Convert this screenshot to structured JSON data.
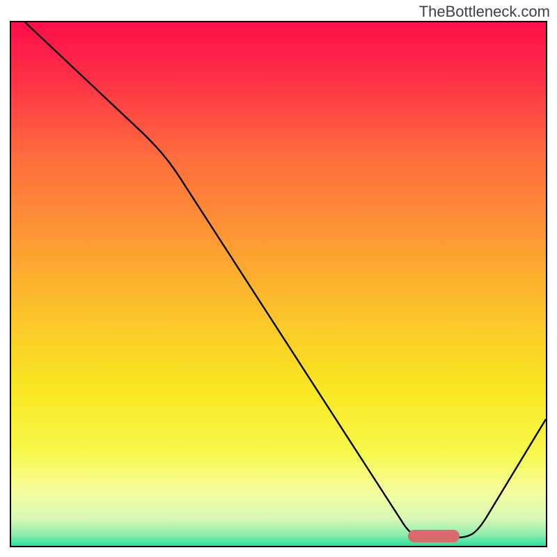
{
  "watermark": "TheBottleneck.com",
  "colors": {
    "curve": "#000000",
    "marker": "#d96a6d",
    "gradient_top": "#ff0d4b",
    "gradient_bottom": "#24e29a"
  },
  "chart_data": {
    "type": "line",
    "title": "",
    "xlabel": "",
    "ylabel": "",
    "xlim": [
      0,
      100
    ],
    "ylim": [
      0,
      100
    ],
    "series": [
      {
        "name": "bottleneck-curve",
        "x": [
          2.6,
          24.7,
          32.6,
          72.9,
          78.1,
          83.3,
          100
        ],
        "y": [
          100,
          78.7,
          68.8,
          4.9,
          1.6,
          1.6,
          24.2
        ]
      }
    ],
    "annotations": [
      {
        "name": "optimal-zone",
        "shape": "rounded-bar",
        "x_range": [
          74.2,
          83.9
        ],
        "y": 2.0,
        "color": "#d96a6d"
      }
    ],
    "background": {
      "type": "vertical-gradient",
      "meaning": "red=high bottleneck, green=low bottleneck",
      "stops": [
        {
          "pos": 0.0,
          "color": "#ff0d4b"
        },
        {
          "pos": 0.1,
          "color": "#ff2e46"
        },
        {
          "pos": 0.25,
          "color": "#ff6a3e"
        },
        {
          "pos": 0.4,
          "color": "#fd9535"
        },
        {
          "pos": 0.55,
          "color": "#fcc22b"
        },
        {
          "pos": 0.7,
          "color": "#f8e721"
        },
        {
          "pos": 0.82,
          "color": "#f7f84a"
        },
        {
          "pos": 0.9,
          "color": "#f4fca0"
        },
        {
          "pos": 0.95,
          "color": "#d5f8b5"
        },
        {
          "pos": 0.98,
          "color": "#8becae"
        },
        {
          "pos": 1.0,
          "color": "#24e29a"
        }
      ]
    }
  }
}
